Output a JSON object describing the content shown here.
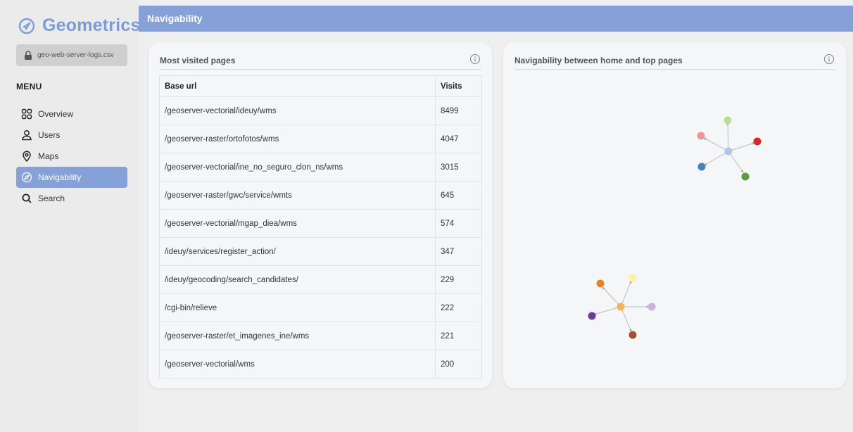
{
  "app": {
    "name": "Geometrics"
  },
  "file": {
    "name": "geo-web-server-logs.csv"
  },
  "menu": {
    "title": "MENU",
    "items": [
      {
        "label": "Overview",
        "icon": "grid-icon"
      },
      {
        "label": "Users",
        "icon": "user-icon"
      },
      {
        "label": "Maps",
        "icon": "map-pin-icon"
      },
      {
        "label": "Navigability",
        "icon": "compass-icon",
        "active": true
      },
      {
        "label": "Search",
        "icon": "search-icon"
      }
    ]
  },
  "header": {
    "title": "Navigability"
  },
  "most_visited": {
    "title": "Most visited pages",
    "columns": [
      "Base url",
      "Visits"
    ],
    "rows": [
      {
        "url": "/geoserver-vectorial/ideuy/wms",
        "visits": "8499"
      },
      {
        "url": "/geoserver-raster/ortofotos/wms",
        "visits": "4047"
      },
      {
        "url": "/geoserver-vectorial/ine_no_seguro_clon_ns/wms",
        "visits": "3015"
      },
      {
        "url": "/geoserver-raster/gwc/service/wmts",
        "visits": "645"
      },
      {
        "url": "/geoserver-vectorial/mgap_diea/wms",
        "visits": "574"
      },
      {
        "url": "/ideuy/services/register_action/",
        "visits": "347"
      },
      {
        "url": "/ideuy/geocoding/search_candidates/",
        "visits": "229"
      },
      {
        "url": "/cgi-bin/relieve",
        "visits": "222"
      },
      {
        "url": "/geoserver-raster/et_imagenes_ine/wms",
        "visits": "221"
      },
      {
        "url": "/geoserver-vectorial/wms",
        "visits": "200"
      }
    ]
  },
  "navigability": {
    "title": "Navigability between home and top pages",
    "colors": {
      "hub1": "#a8c8e8",
      "hub2": "#f2b45e",
      "node_green_light": "#b5e08d",
      "node_pink": "#e89a9a",
      "node_red": "#d62828",
      "node_blue": "#4f7fbf",
      "node_green": "#5a9e3a",
      "node_orange": "#e8802a",
      "node_yellow": "#f8f4a0",
      "node_lavender": "#c8b4dc",
      "node_purple": "#6a3e9a",
      "node_brown": "#a0522d"
    }
  },
  "accent_color": "#86a0d8"
}
